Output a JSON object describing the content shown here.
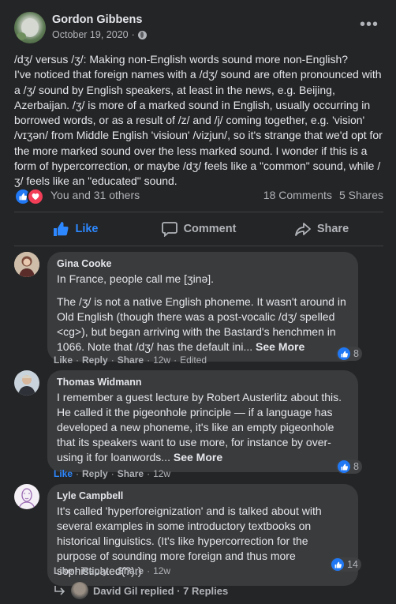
{
  "post": {
    "author": "Gordon Gibbens",
    "date": "October 19, 2020",
    "date_separator": "·",
    "paragraphs": [
      "/dʒ/ versus /ʒ/: Making non-English words sound more non-English?",
      "I've noticed that foreign names with a /dʒ/ sound are often pronounced with a /ʒ/ sound by English speakers, at least in the news, e.g. Beijing, Azerbaijan. /ʒ/ is more of a marked sound in English, usually occurring in borrowed words, or as a result of /z/ and /j/ coming together, e.g. 'vision' /vɪʒən/ from Middle English 'visioun' /vizjun/, so it's strange that we'd opt for the more marked sound over the less marked sound. I wonder if this is a form of hypercorrection, or maybe /dʒ/ feels like a \"common\" sound, while /ʒ/ feels like an \"educated\" sound."
    ],
    "reactions_text": "You and 31 others",
    "comments_count": "18 Comments",
    "shares_count": "5 Shares"
  },
  "actions": {
    "like": "Like",
    "comment": "Comment",
    "share": "Share"
  },
  "comments": [
    {
      "name": "Gina Cooke",
      "paragraphs": [
        "In France, people call me [ʒinə].",
        "The /ʒ/ is not a native English phoneme. It wasn't around in Old English (though there was a post-vocalic /dʒ/ spelled <cg>), but began arriving with the Bastard's henchmen in 1066. Note that /dʒ/ has the default ini..."
      ],
      "see_more": "See More",
      "reaction_count": "8",
      "like": "Like",
      "reply": "Reply",
      "share": "Share",
      "time": "12w",
      "edited": "Edited"
    },
    {
      "name": "Thomas Widmann",
      "paragraphs": [
        "I remember a guest lecture by Robert Austerlitz about this. He called it the pigeonhole principle — if a language has developed a new phoneme, it's like an empty pigeonhole that its speakers want to use more, for instance by over-using it for loanwords..."
      ],
      "see_more": "See More",
      "reaction_count": "8",
      "like": "Like",
      "reply": "Reply",
      "share": "Share",
      "time": "12w"
    },
    {
      "name": "Lyle Campbell",
      "paragraphs": [
        "It's called 'hyperforeignization' and is talked about with several examples in some introductory textbooks on historical linguistics. (It's like hypercorrection for the purpose of sounding more foreign and thus more sophisticated(?).)"
      ],
      "reaction_count": "14",
      "like": "Like",
      "reply": "Reply",
      "share": "Share",
      "time": "12w"
    }
  ],
  "replies_summary": "David Gil replied · 7 Replies",
  "colors": {
    "accent": "#2d88ff",
    "like": "#2078f4",
    "love": "#f33e58",
    "background": "#242526",
    "bubble": "#3a3b3c"
  },
  "icons": [
    "globe-icon",
    "more-icon",
    "like-icon",
    "comment-icon",
    "share-icon",
    "reply-arrow-icon"
  ]
}
